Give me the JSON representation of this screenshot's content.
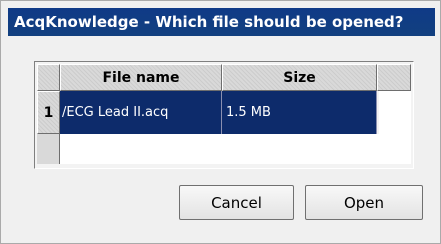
{
  "window": {
    "title": "AcqKnowledge - Which file should be opened?"
  },
  "table": {
    "headers": {
      "file_name": "File name",
      "size": "Size"
    },
    "rows": [
      {
        "row_number": "1",
        "file_name": "/ECG Lead II.acq",
        "size": "1.5 MB",
        "selected": true
      }
    ],
    "selection_color": "#0d2b6b"
  },
  "buttons": {
    "cancel_label": "Cancel",
    "open_label": "Open"
  }
}
